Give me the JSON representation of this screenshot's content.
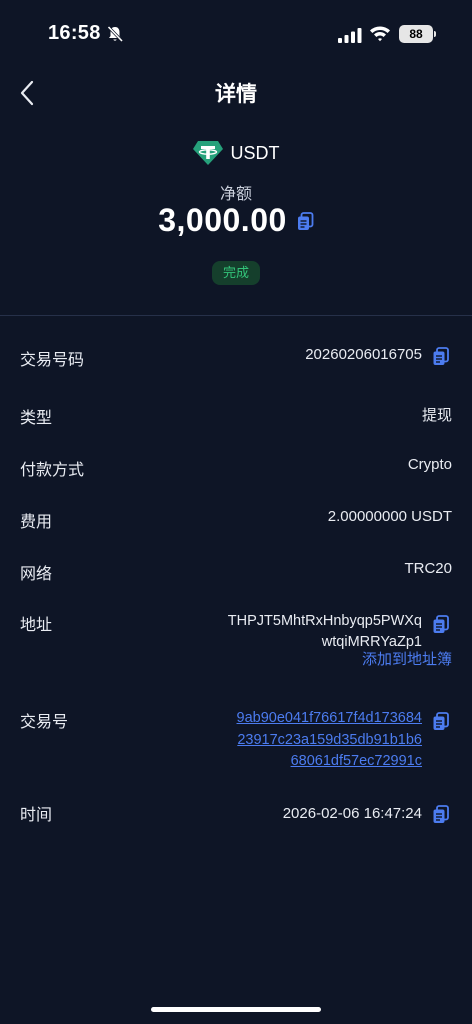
{
  "status_bar": {
    "time": "16:58",
    "battery": "88",
    "icons": [
      "bell-slash-icon",
      "signal-icon",
      "wifi-icon",
      "battery-icon"
    ]
  },
  "nav": {
    "back_icon": "chevron-left-icon",
    "title": "详情"
  },
  "hero": {
    "coin_icon": "tether-logo-icon",
    "coin": "USDT",
    "net_label": "净额",
    "amount": "3,000.00",
    "status": "完成"
  },
  "details": {
    "tx_number": {
      "label": "交易号码",
      "value": "20260206016705"
    },
    "type": {
      "label": "类型",
      "value": "提现"
    },
    "payment_method": {
      "label": "付款方式",
      "value": "Crypto"
    },
    "fee": {
      "label": "费用",
      "value": "2.00000000 USDT"
    },
    "network": {
      "label": "网络",
      "value": "TRC20"
    },
    "address": {
      "label": "地址",
      "line1": "THPJT5MhtRxHnbyqp5PWXq",
      "line2": "wtqiMRRYaZp1",
      "add_link": "添加到地址簿"
    },
    "tx_hash": {
      "label": "交易号",
      "line1": "9ab90e041f76617f4d173684",
      "line2": "23917c23a159d35db91b1b6",
      "line3": "68061df57ec72991c"
    },
    "time": {
      "label": "时间",
      "value": "2026-02-06 16:47:24"
    }
  },
  "colors": {
    "background": "#0e1526",
    "accent_link": "#4c7cf0",
    "status_green": "#33c47a",
    "tether_teal": "#26a17b"
  }
}
